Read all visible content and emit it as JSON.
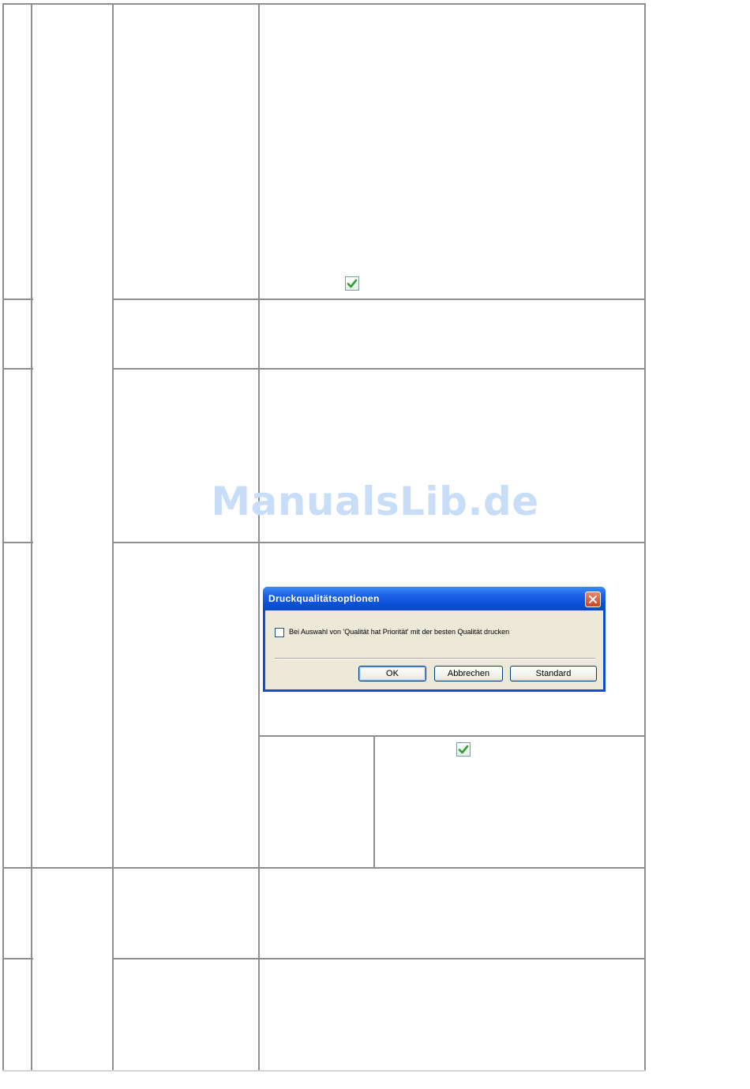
{
  "watermark": "ManualsLib.de",
  "dialog": {
    "title": "Druckqualitätsoptionen",
    "checkbox_label": "Bei Auswahl von 'Qualität hat Priorität' mit der besten Qualität drucken",
    "checkbox_checked": false,
    "buttons": {
      "ok": "OK",
      "cancel": "Abbrechen",
      "default": "Standard"
    }
  },
  "icons": {
    "check": "check-icon",
    "close": "close-icon"
  },
  "colors": {
    "grid": "#8e8e8e",
    "watermark": "#c8def8",
    "titlebar": "#0a52d8",
    "dialog_body": "#ece9d8",
    "check_mark": "#2e9e2e"
  }
}
